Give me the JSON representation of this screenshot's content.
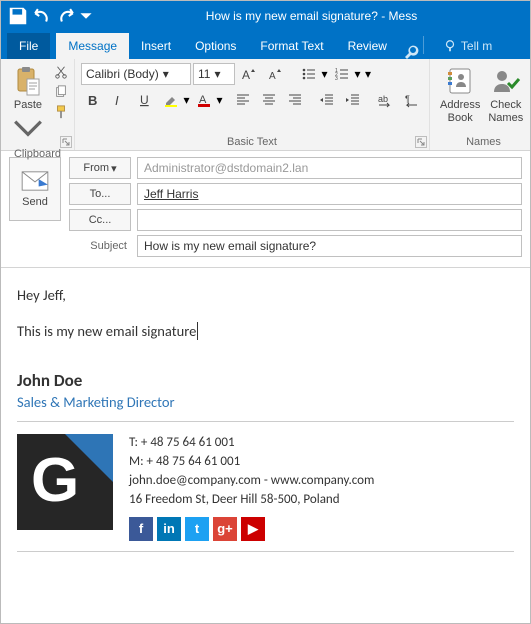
{
  "titlebar": {
    "title": "How is my new email signature?  -  Mess"
  },
  "tabs": {
    "file": "File",
    "message": "Message",
    "insert": "Insert",
    "options": "Options",
    "format_text": "Format Text",
    "review": "Review",
    "tell_me": "Tell m"
  },
  "ribbon": {
    "clipboard": {
      "paste": "Paste",
      "group_label": "Clipboard"
    },
    "basictext": {
      "font_name": "Calibri (Body)",
      "font_size": "11",
      "group_label": "Basic Text"
    },
    "names": {
      "address_book": "Address\nBook",
      "check_names": "Check\nNames",
      "group_label": "Names"
    }
  },
  "header": {
    "from_label": "From",
    "to_label": "To...",
    "cc_label": "Cc...",
    "subject_label": "Subject",
    "send_label": "Send",
    "from_value": "Administrator@dstdomain2.lan",
    "to_value": "Jeff Harris",
    "cc_value": "",
    "subject_value": "How is my new email signature?"
  },
  "body": {
    "greeting": "Hey Jeff,",
    "line1": "This is my new email signature"
  },
  "signature": {
    "name": "John Doe",
    "title": "Sales & Marketing Director",
    "phone_t": "T: + 48 75 64 61 001",
    "phone_m": "M: + 48 75 64 61 001",
    "email": "john.doe@company.com",
    "dash": " - ",
    "web": "www.company.com",
    "address": "16 Freedom St, Deer Hill 58-500, Poland",
    "logo_letter": "G",
    "social": {
      "fb": "f",
      "li": "in",
      "tw": "t",
      "gp": "g+",
      "yt": "▶"
    }
  }
}
